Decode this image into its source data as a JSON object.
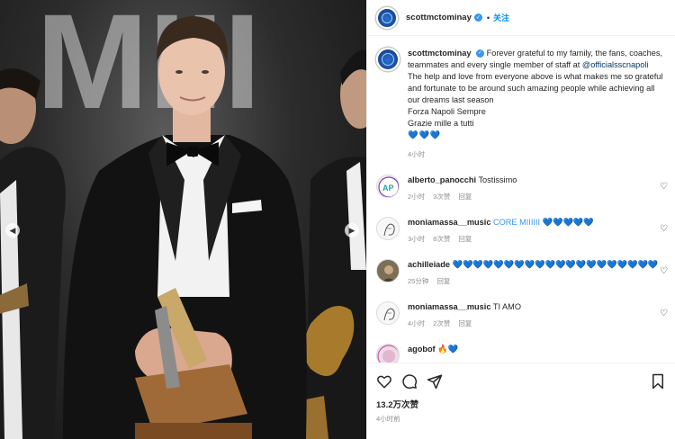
{
  "post": {
    "username": "scottmctominay",
    "follow_label": "关注",
    "separator": "•",
    "caption": {
      "lines": [
        "Forever grateful to my family, the fans, coaches, teammates and every single member of staff at",
        "@officialsscnapoli",
        "The help and love from everyone above is what makes me so grateful and fortunate to be around such amazing people while achieving all our dreams last season",
        "Forza Napoli Sempre",
        "Grazie mille a tutti",
        "💙💙💙"
      ],
      "time": "4小时"
    },
    "backdrop_letters": "MIII"
  },
  "comments": [
    {
      "username": "alberto_panocchi",
      "text": "Tostissimo",
      "time": "2小时",
      "likes": "3次赞",
      "reply": "回复",
      "avatar_icon": "monogram-avatar"
    },
    {
      "username": "moniamassa__music",
      "text": "CORE MIIIIII 💙💙💙💙💙",
      "time": "3小时",
      "likes": "8次赞",
      "reply": "回复",
      "avatar_icon": "sketch-avatar"
    },
    {
      "username": "achilleiade",
      "text": "💙💙💙💙💙💙💙💙💙💙💙💙💙💙💙💙💙💙💙💙",
      "time": "25分钟",
      "likes": "",
      "reply": "回复",
      "avatar_icon": "photo-avatar"
    },
    {
      "username": "moniamassa__music",
      "text": "TI AMO",
      "time": "4小时",
      "likes": "2次赞",
      "reply": "回复",
      "avatar_icon": "sketch-avatar"
    },
    {
      "username": "agobof",
      "text": "🔥💙",
      "time": "",
      "likes": "",
      "reply": "",
      "avatar_icon": "gradient-avatar"
    }
  ],
  "actions": {
    "like_count": "13.2万次赞",
    "posted_time": "4小时前"
  },
  "colors": {
    "accent_blue": "#0095f6",
    "verified_blue": "#3897f0",
    "muted_text": "#8e8e8e"
  }
}
